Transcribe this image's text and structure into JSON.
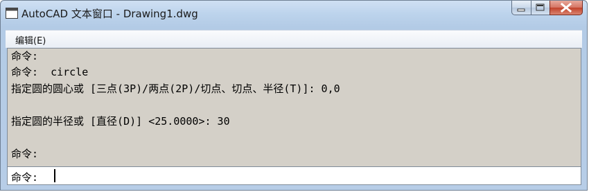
{
  "window": {
    "title": "AutoCAD 文本窗口 - Drawing1.dwg"
  },
  "menu": {
    "items": [
      {
        "label": "编辑(E)"
      }
    ]
  },
  "history": {
    "lines": [
      "命令:",
      "命令:  circle",
      "指定圆的圆心或 [三点(3P)/两点(2P)/切点、切点、半径(T)]: 0,0",
      "",
      "指定圆的半径或 [直径(D)] <25.0000>: 30",
      "",
      "命令:"
    ]
  },
  "command_line": {
    "prompt": "命令:",
    "value": ""
  },
  "colors": {
    "history_bg": "#d4d0c8",
    "frame": "#b7cde7",
    "close_button": "#c2432c"
  },
  "icons": {
    "app": "window-icon",
    "minimize": "minimize-icon",
    "maximize": "maximize-icon",
    "close": "close-icon"
  }
}
